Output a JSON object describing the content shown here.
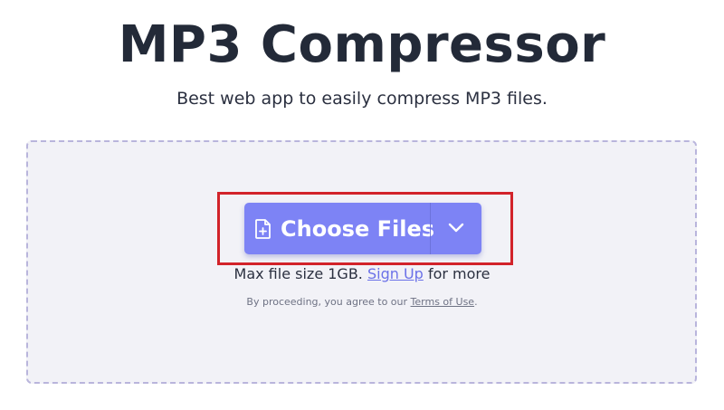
{
  "header": {
    "title": "MP3 Compressor",
    "subtitle": "Best web app to easily compress MP3 files."
  },
  "upload": {
    "choose_label": "Choose Files",
    "file_icon": "file-plus-icon",
    "menu_icon": "chevron-down-icon",
    "limit_prefix": "Max file size 1GB.",
    "signup_label": "Sign Up",
    "limit_suffix": "for more",
    "terms_prefix": "By proceeding, you agree to our",
    "terms_link": "Terms of Use",
    "terms_suffix": "."
  },
  "colors": {
    "button": "#7d83f5",
    "highlight": "#d2232a",
    "dropzone_bg": "#f2f2f7",
    "dropzone_border": "#b9b5dc",
    "link": "#6b71e8"
  }
}
